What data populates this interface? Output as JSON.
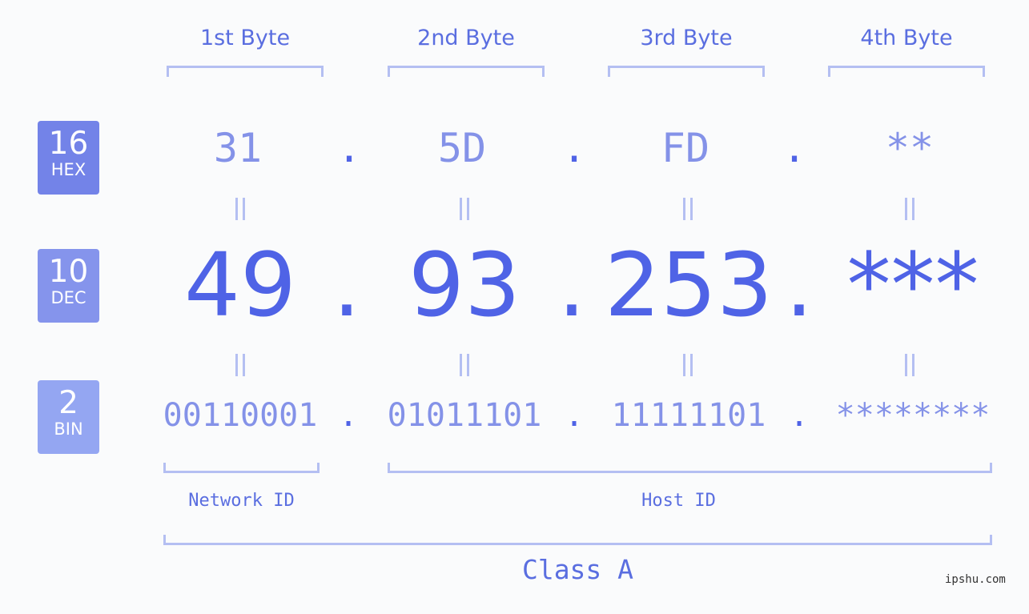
{
  "byte_headers": [
    "1st Byte",
    "2nd Byte",
    "3rd Byte",
    "4th Byte"
  ],
  "badges": {
    "hex": {
      "number": "16",
      "label": "HEX",
      "color": "#7383e8"
    },
    "dec": {
      "number": "10",
      "label": "DEC",
      "color": "#8594ec"
    },
    "bin": {
      "number": "2",
      "label": "BIN",
      "color": "#94a6f2"
    }
  },
  "hex_values": [
    "31",
    "5D",
    "FD",
    "**"
  ],
  "dec_values": [
    "49",
    "93",
    "253",
    "***"
  ],
  "bin_values": [
    "00110001",
    "01011101",
    "11111101",
    "********"
  ],
  "separator": ".",
  "network_id_label": "Network ID",
  "host_id_label": "Host ID",
  "class_label": "Class A",
  "watermark": "ipshu.com",
  "colors": {
    "primary": "#4f63e6",
    "light": "#8492e8",
    "bracket": "#b4bff2",
    "background": "#fafbfc"
  }
}
